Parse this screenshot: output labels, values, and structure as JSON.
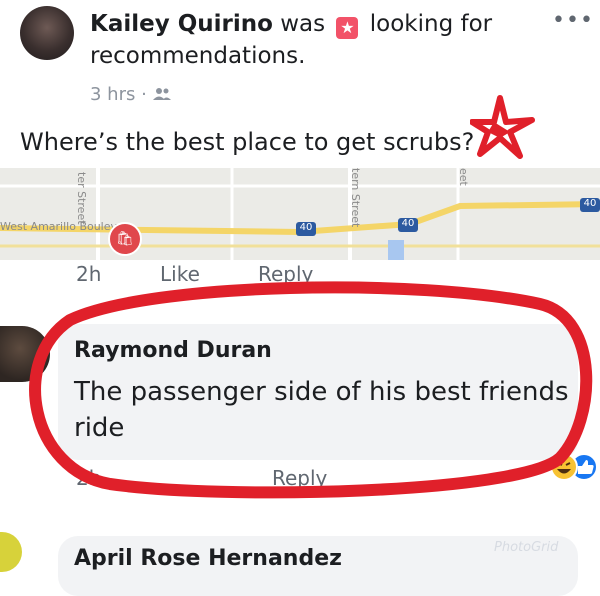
{
  "post": {
    "author": "Kailey Quirino",
    "action_prefix": "was",
    "action_suffix": "looking for recommendations.",
    "time": "3 hrs",
    "dot": "·",
    "question": "Where’s the best place to get scrubs?",
    "more_label": "•••"
  },
  "map": {
    "street_left": "West Amarillo Bouleva",
    "street_vert1": "ter Street",
    "street_vert2": "tern Street",
    "street_vert3": "eet",
    "shield_1": "40",
    "shield_2": "40",
    "shield_3": "40"
  },
  "post_actions": {
    "time": "2h",
    "like": "Like",
    "reply": "Reply"
  },
  "comment1": {
    "author": "Raymond Duran",
    "text": "The passenger side of his best friends ride",
    "time": "2h",
    "reply": "Reply"
  },
  "comment2": {
    "author": "April Rose Hernandez"
  },
  "watermark": "PhotoGrid",
  "colors": {
    "annotation_red": "#e0202a",
    "link_blue": "#1877f2",
    "bubble_gray": "#f2f3f5",
    "meta_gray": "#606770"
  }
}
